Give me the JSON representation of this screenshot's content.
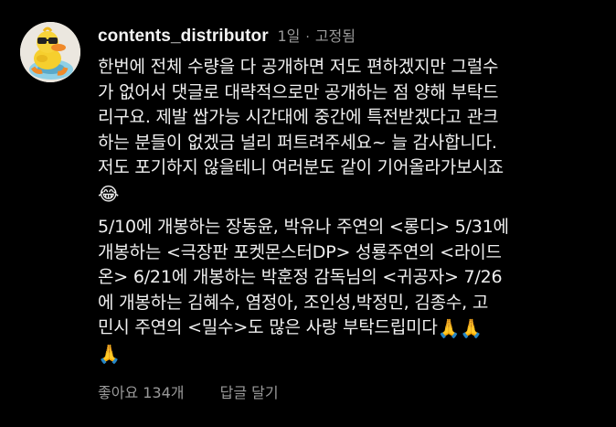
{
  "comment": {
    "username": "contents_distributor",
    "time": "1일",
    "separator": "·",
    "pinned": "고정됨",
    "paragraph1": [
      "한번에 전체 수량을 다 공개하면 저도 편하겠지만 그럴수",
      "가 없어서 댓글로 대략적으로만 공개하는 점 양해 부탁드",
      "리구요. 제발 쌉가능 시간대에 중간에 특전받겠다고 관크",
      "하는 분들이 없겠금 널리 퍼트려주세요~ 늘 감사합니다.",
      "저도 포기하지 않을테니 여러분도 같이 기어올라가보시죠"
    ],
    "paragraph1_emoji": "😂",
    "paragraph2": [
      "5/10에 개봉하는 장동윤, 박유나 주연의 <롱디> 5/31에",
      "개봉하는 <극장판 포켓몬스터DP> 성룡주연의 <라이드",
      "온> 6/21에 개봉하는 박훈정 감독님의 <귀공자> 7/26",
      "에 개봉하는 김혜수, 염정아, 조인성,박정민, 김종수, 고",
      "민시 주연의 <밀수>도 많은 사랑 부탁드립미다"
    ],
    "paragraph2_emoji_inline": "🙏🙏",
    "paragraph2_emoji_last": "🙏",
    "likes": "좋아요 134개",
    "reply": "답글 달기",
    "avatar_icon": "rubber-duck-avatar",
    "colors": {
      "background": "#000000",
      "text": "#f0f0f0",
      "meta": "#9a9a9a"
    }
  }
}
